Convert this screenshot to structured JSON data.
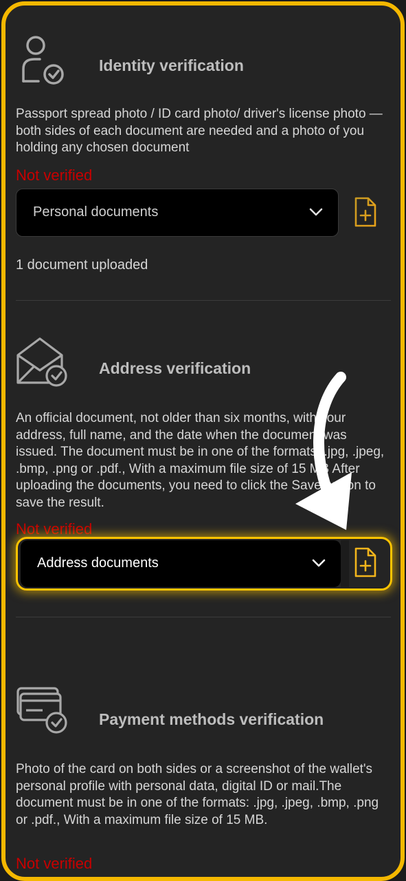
{
  "identity": {
    "title": "Identity verification",
    "icon": "person-check-icon",
    "description": "Passport spread photo / ID card photo/ driver's license photo — both sides of each document are needed and a photo of you holding any chosen document",
    "status": "Not verified",
    "select_value": "Personal documents",
    "uploaded": "1 document uploaded"
  },
  "address": {
    "title": "Address verification",
    "icon": "envelope-check-icon",
    "description": "An official document, not older than six months, with your address, full name, and the date when the document was issued. The document must be in one of the formats: .jpg, .jpeg, .bmp, .png or .pdf., With a maximum file size of 15 MB After uploading the documents, you need to click the Save button to save the result.",
    "status": "Not verified",
    "select_value": "Address documents"
  },
  "payment": {
    "title": "Payment methods verification",
    "icon": "cards-check-icon",
    "description": "Photo of the card on both sides or a screenshot of the wallet's personal profile with personal data, digital ID or mail.The document must be in one of the formats: .jpg, .jpeg, .bmp, .png or .pdf., With a maximum file size of 15 MB.",
    "status": "Not verified"
  },
  "colors": {
    "frame": "#f5b800",
    "status": "#c80000",
    "background": "#242424"
  }
}
